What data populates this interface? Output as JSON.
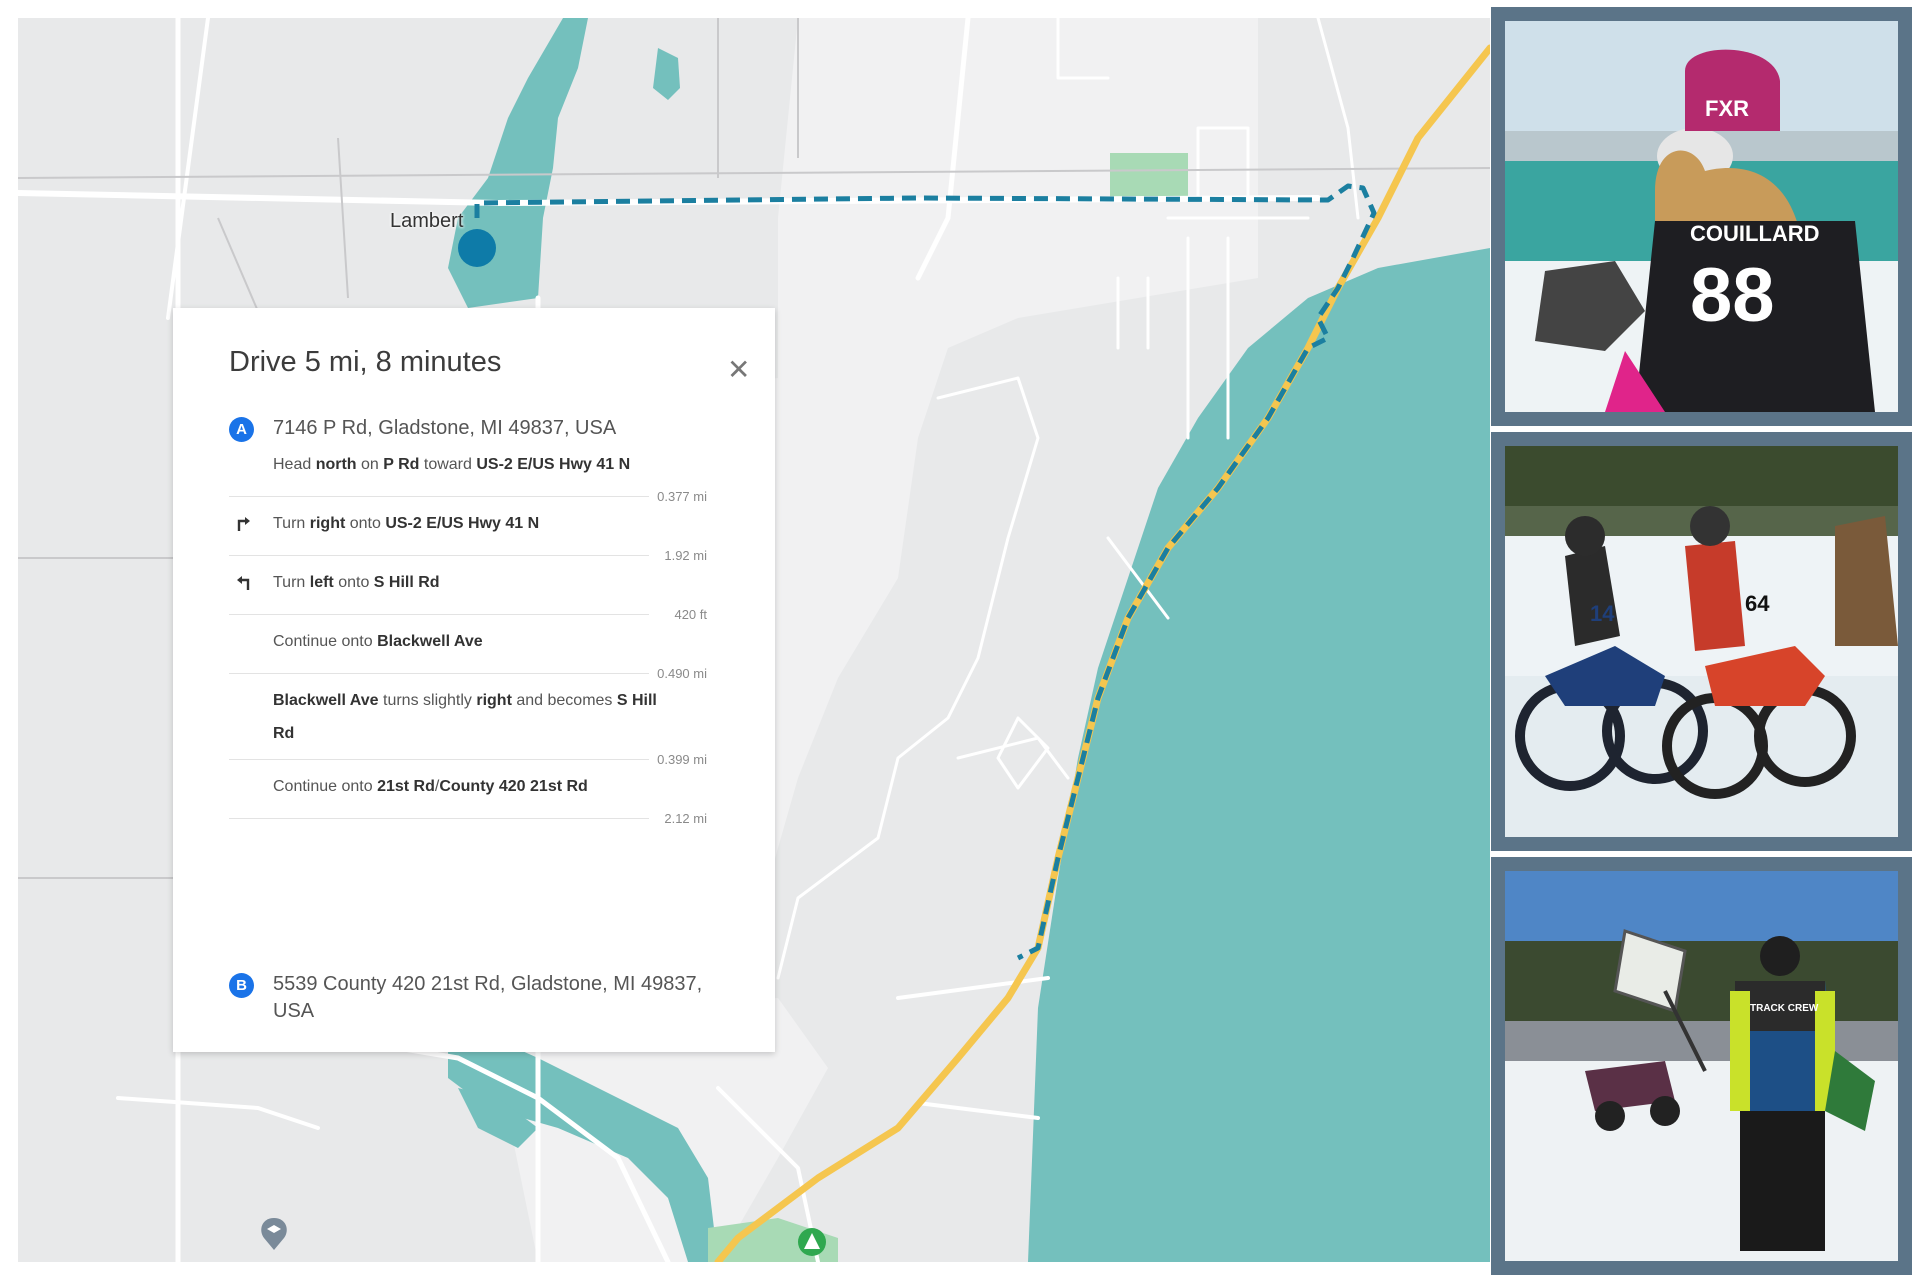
{
  "map": {
    "place_label": "Lambert",
    "colors": {
      "land": "#e8e9ea",
      "water": "#74c0bd",
      "road": "#ffffff",
      "highway": "#f5c64f",
      "route": "#1b7fa0",
      "park": "#a8dab5",
      "origin_marker": "#0e7ba8"
    },
    "poi_icons": [
      "school-icon",
      "campground-icon"
    ]
  },
  "directions": {
    "title": "Drive 5 mi, 8 minutes",
    "close_icon": "close-icon",
    "origin": {
      "badge": "A",
      "address": "7146 P Rd, Gladstone, MI 49837, USA"
    },
    "destination": {
      "badge": "B",
      "address_line1": "5539 County 420 21st Rd, Gladstone, MI 49837,",
      "address_line2": "USA"
    },
    "steps": [
      {
        "icon": "",
        "parts": [
          [
            "Head ",
            0
          ],
          [
            "north",
            1
          ],
          [
            " on ",
            0
          ],
          [
            "P Rd",
            1
          ],
          [
            " toward ",
            0
          ],
          [
            "US-2 E/US Hwy 41 N",
            1
          ]
        ],
        "distance": "0.377 mi"
      },
      {
        "icon": "turn-right-icon",
        "parts": [
          [
            "Turn ",
            0
          ],
          [
            "right",
            1
          ],
          [
            " onto ",
            0
          ],
          [
            "US-2 E/US Hwy 41 N",
            1
          ]
        ],
        "distance": "1.92 mi"
      },
      {
        "icon": "turn-left-icon",
        "parts": [
          [
            "Turn ",
            0
          ],
          [
            "left",
            1
          ],
          [
            " onto ",
            0
          ],
          [
            "S Hill Rd",
            1
          ]
        ],
        "distance": "420 ft"
      },
      {
        "icon": "",
        "parts": [
          [
            "Continue onto ",
            0
          ],
          [
            "Blackwell Ave",
            1
          ]
        ],
        "distance": "0.490 mi"
      },
      {
        "icon": "",
        "parts": [
          [
            "Blackwell Ave",
            1
          ],
          [
            " turns slightly ",
            0
          ],
          [
            "right",
            1
          ],
          [
            " and becomes ",
            0
          ],
          [
            "S Hill Rd",
            1
          ]
        ],
        "distance": "0.399 mi"
      },
      {
        "icon": "",
        "parts": [
          [
            "Continue onto ",
            0
          ],
          [
            "21st Rd",
            1
          ],
          [
            "/",
            0
          ],
          [
            "County 420 21st Rd",
            1
          ]
        ],
        "distance": "2.12 mi"
      }
    ]
  },
  "photos": {
    "frame_color": "#5b7488",
    "items": [
      {
        "helmet_text": "FXR",
        "jersey_name": "COUILLARD",
        "jersey_number": "88"
      },
      {
        "bike_numbers": [
          "14",
          "64"
        ]
      },
      {
        "vest_text": "TRACK CREW"
      }
    ]
  }
}
